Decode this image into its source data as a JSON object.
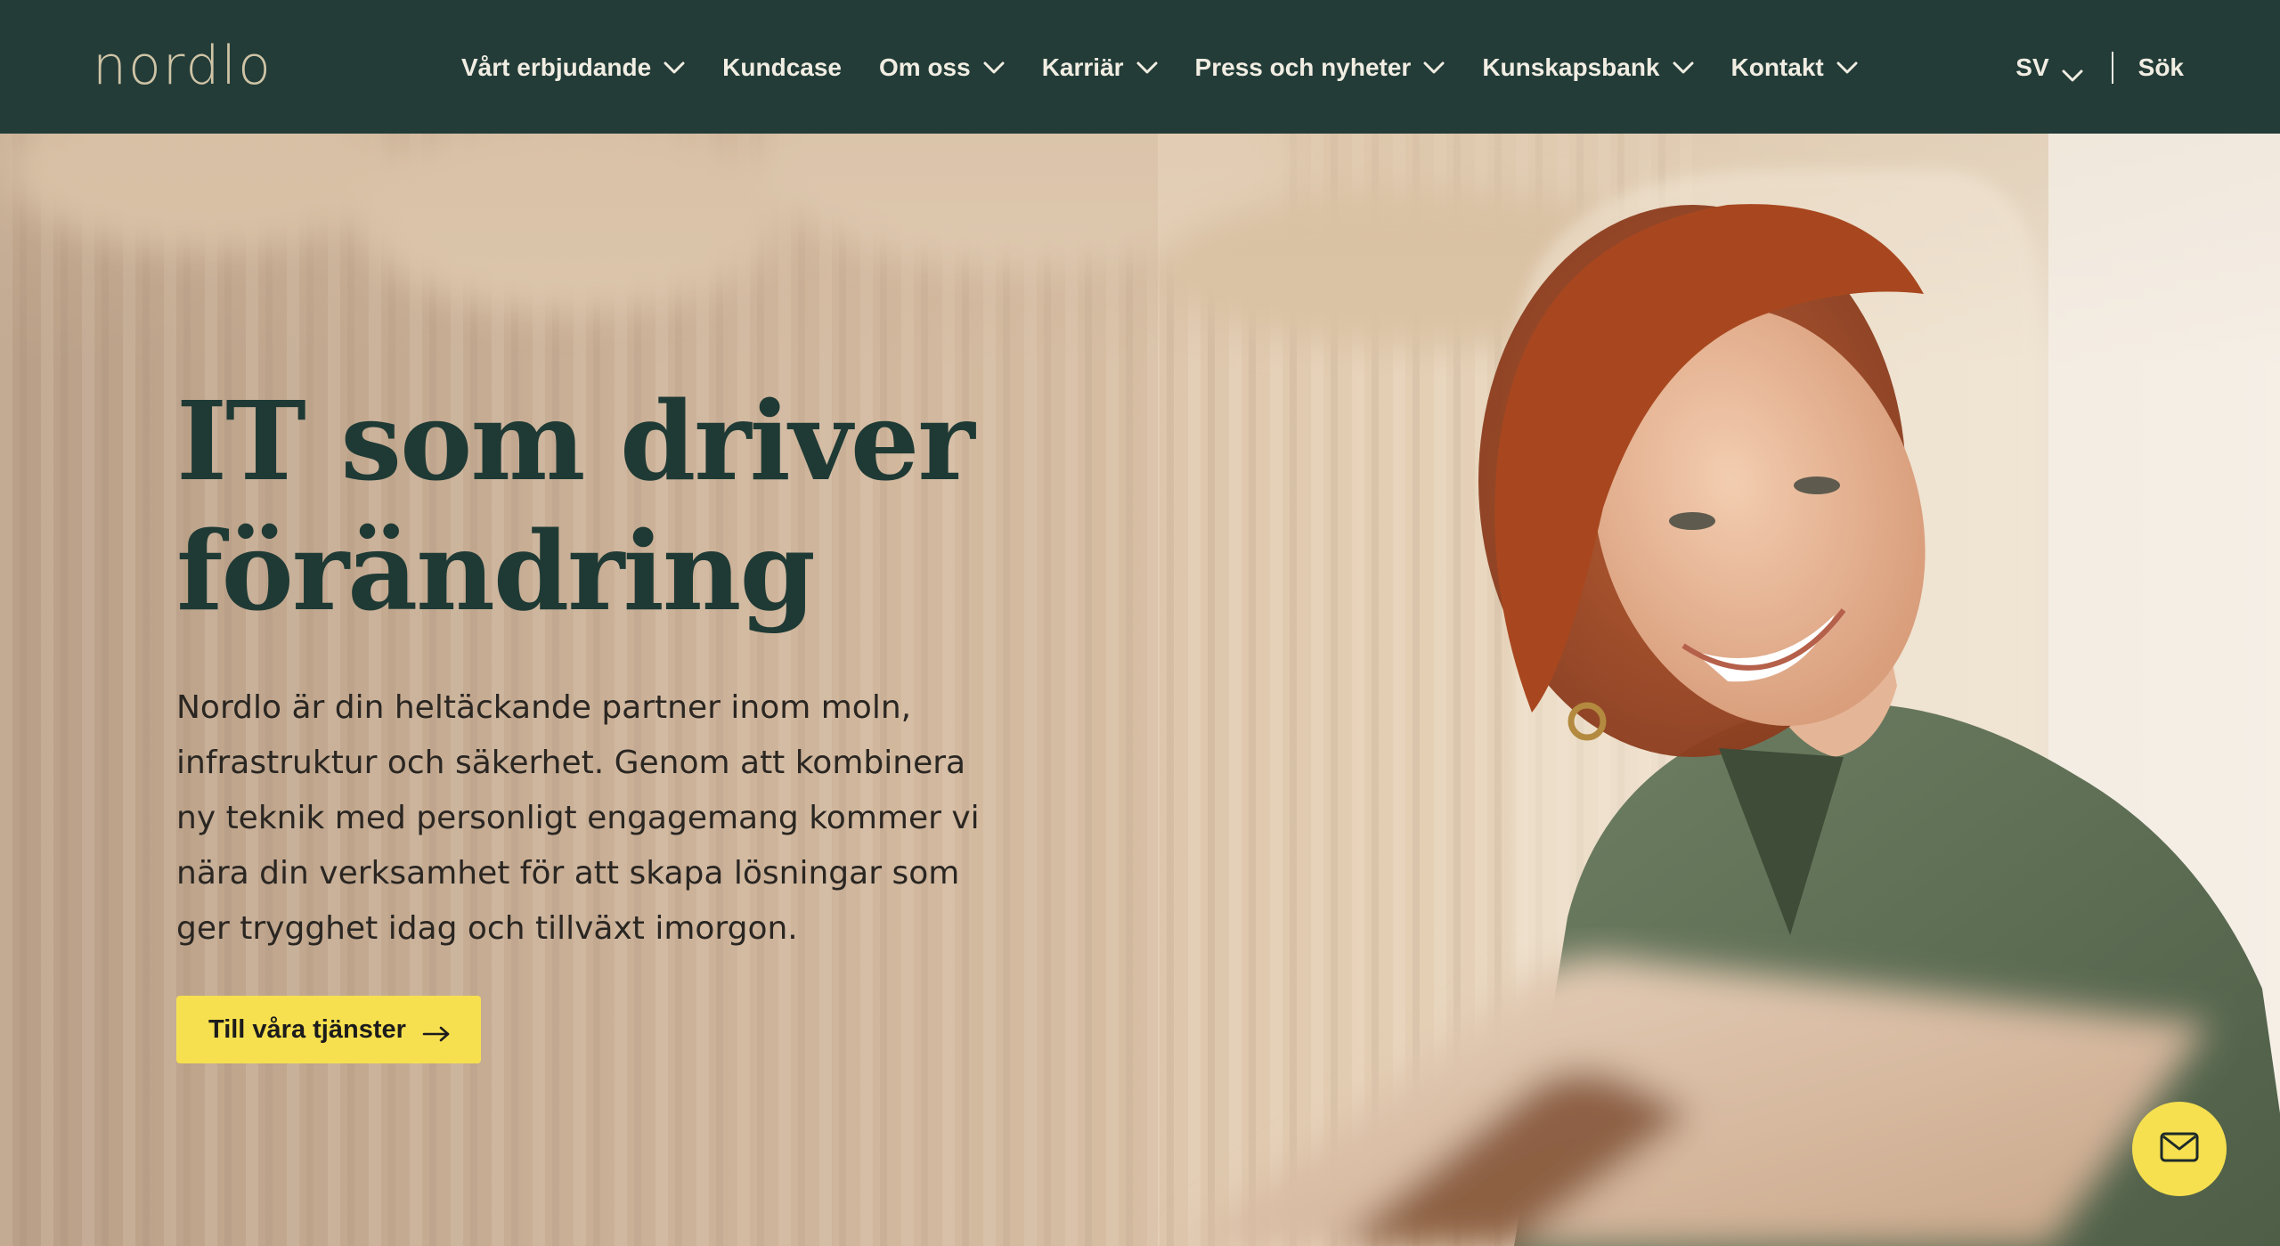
{
  "brand": {
    "logo_text": "nordlo"
  },
  "nav": {
    "items": [
      {
        "label": "Vårt erbjudande",
        "has_dropdown": true
      },
      {
        "label": "Kundcase",
        "has_dropdown": false
      },
      {
        "label": "Om oss",
        "has_dropdown": true
      },
      {
        "label": "Karriär",
        "has_dropdown": true
      },
      {
        "label": "Press och nyheter",
        "has_dropdown": true
      },
      {
        "label": "Kunskapsbank",
        "has_dropdown": true
      },
      {
        "label": "Kontakt",
        "has_dropdown": true
      }
    ],
    "language": "SV",
    "search_label": "Sök"
  },
  "hero": {
    "title_line1": "IT som driver",
    "title_line2": "förändring",
    "text": "Nordlo är din heltäckande partner inom moln, infrastruktur och säkerhet. Genom att kombinera ny teknik med personligt engagemang kommer vi nära din verksamhet för att skapa lösningar som ger trygghet idag och tillväxt imorgon.",
    "cta_label": "Till våra tjänster"
  },
  "icons": {
    "chevron": "chevron-down-icon",
    "arrow": "arrow-right-icon",
    "mail": "mail-icon"
  },
  "colors": {
    "header_bg": "#233c38",
    "logo": "#cfc4a6",
    "nav_text": "#f1ede2",
    "title": "#1f3a35",
    "accent_yellow": "#f6e04f"
  }
}
